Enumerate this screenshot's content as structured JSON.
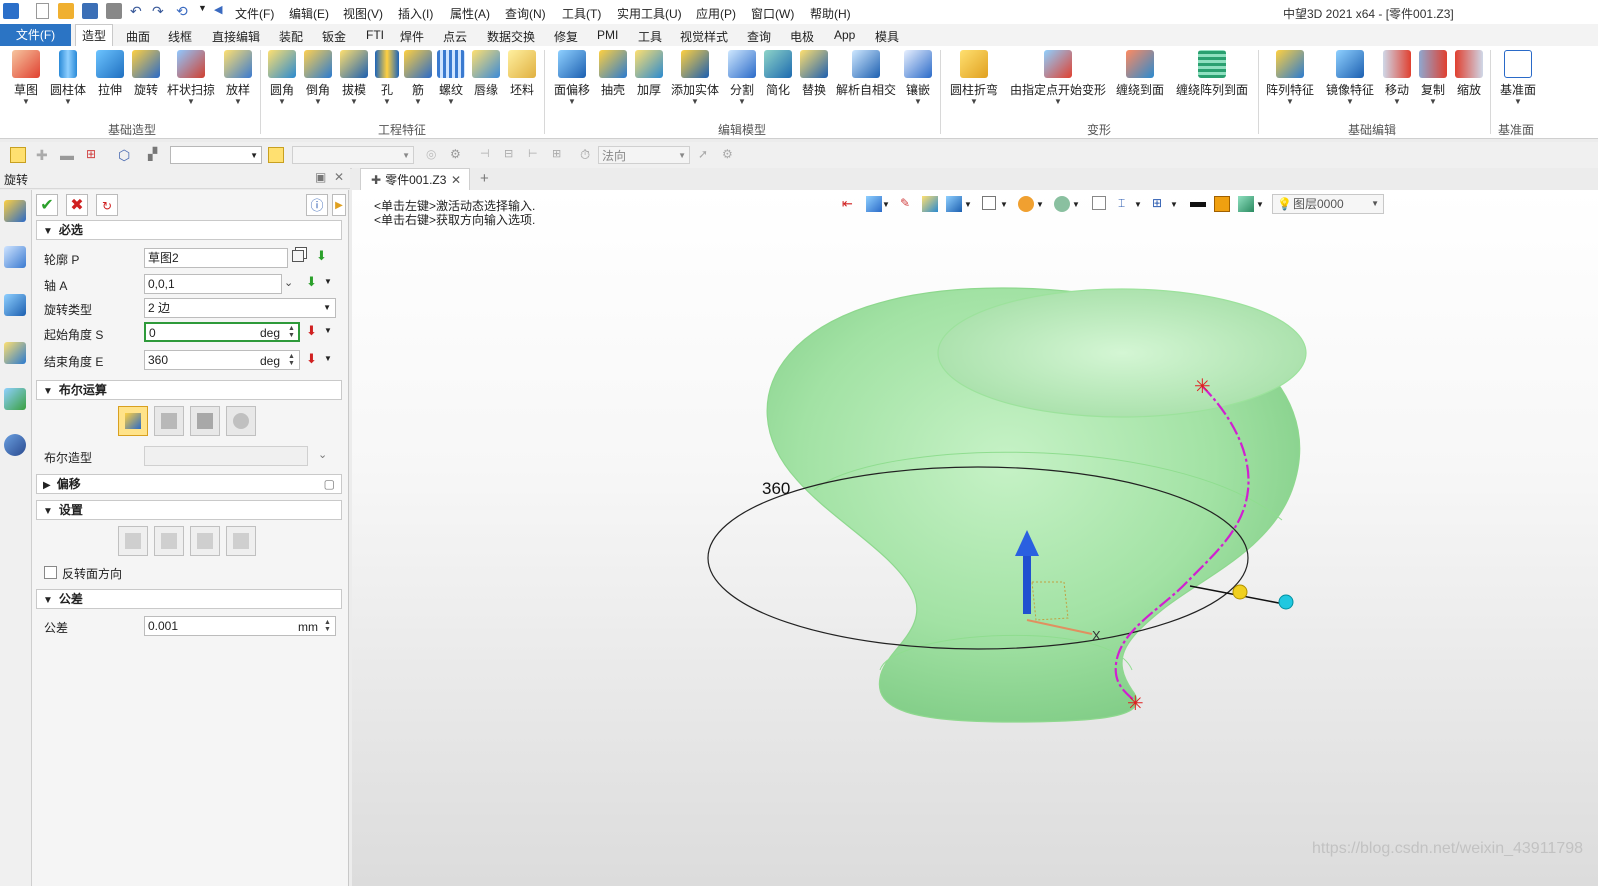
{
  "titlebar": {
    "menus": [
      "文件(F)",
      "编辑(E)",
      "视图(V)",
      "插入(I)",
      "属性(A)",
      "查询(N)",
      "工具(T)",
      "实用工具(U)",
      "应用(P)",
      "窗口(W)",
      "帮助(H)"
    ],
    "app_title": "中望3D 2021 x64 - [零件001.Z3]"
  },
  "tabs": [
    "文件(F)",
    "造型",
    "曲面",
    "线框",
    "直接编辑",
    "装配",
    "钣金",
    "FTI",
    "焊件",
    "点云",
    "数据交换",
    "修复",
    "PMI",
    "工具",
    "视觉样式",
    "查询",
    "电极",
    "App",
    "模具"
  ],
  "active_tab": "造型",
  "ribbon": {
    "groups": [
      {
        "label": "基础造型",
        "buttons": [
          "草图",
          "圆柱体",
          "拉伸",
          "旋转",
          "杆状扫掠",
          "放样"
        ]
      },
      {
        "label": "工程特征",
        "buttons": [
          "圆角",
          "倒角",
          "拔模",
          "孔",
          "筋",
          "螺纹",
          "唇缘",
          "坯料"
        ]
      },
      {
        "label": "编辑模型",
        "buttons": [
          "面偏移",
          "抽壳",
          "加厚",
          "添加实体",
          "分割",
          "简化",
          "替换",
          "解析自相交",
          "镶嵌"
        ]
      },
      {
        "label": "变形",
        "buttons": [
          "圆柱折弯",
          "由指定点开始变形",
          "缠绕到面",
          "缠绕阵列到面"
        ]
      },
      {
        "label": "基础编辑",
        "buttons": [
          "阵列特征",
          "镜像特征",
          "移动",
          "复制",
          "缩放"
        ]
      },
      {
        "label": "基准面",
        "buttons": [
          "基准面"
        ]
      }
    ]
  },
  "toolbar2": {
    "direction_placeholder": "法向"
  },
  "panel": {
    "title": "旋转",
    "sections": {
      "required": "必选",
      "boolean": "布尔运算",
      "offset": "偏移",
      "settings": "设置",
      "tolerance": "公差"
    },
    "fields": {
      "profile_label": "轮廓 P",
      "profile_value": "草图2",
      "axis_label": "轴 A",
      "axis_value": "0,0,1",
      "type_label": "旋转类型",
      "type_value": "2 边",
      "start_label": "起始角度 S",
      "start_value": "0",
      "start_unit": "deg",
      "end_label": "结束角度 E",
      "end_value": "360",
      "end_unit": "deg",
      "bool_shape_label": "布尔造型",
      "reverse_label": "反转面方向",
      "tol_label": "公差",
      "tol_value": "0.001",
      "tol_unit": "mm"
    }
  },
  "document_tab": "零件001.Z3",
  "viewport": {
    "hint1": "<单击左键>激活动态选择输入.",
    "hint2": "<单击右键>获取方向输入选项.",
    "layer": "图层0000",
    "angle_label": "360",
    "axis_x_label": "X"
  },
  "watermark": "https://blog.csdn.net/weixin_43911798",
  "colors": {
    "accent": "#2b74c4",
    "model": "#9fe0a0",
    "profile": "#d020d0"
  }
}
